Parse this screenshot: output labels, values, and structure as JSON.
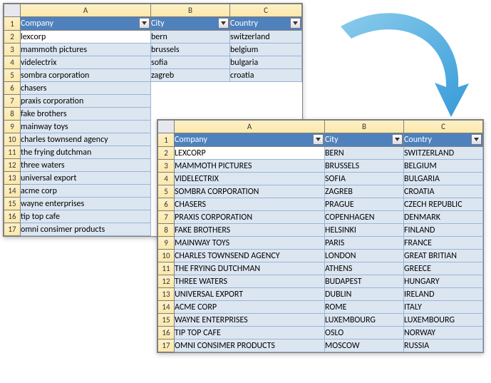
{
  "columns": [
    "A",
    "B",
    "C"
  ],
  "headers": {
    "company": "Company",
    "city": "City",
    "country": "Country"
  },
  "sheet1": {
    "visibleCols": 3,
    "cutB": 5,
    "rows": [
      {
        "n": 1
      },
      {
        "n": 2,
        "a": "lexcorp",
        "b": "bern",
        "c": "switzerland",
        "active": true
      },
      {
        "n": 3,
        "a": "mammoth pictures",
        "b": "brussels",
        "c": "belgium"
      },
      {
        "n": 4,
        "a": "videlectrix",
        "b": "sofia",
        "c": "bulgaria"
      },
      {
        "n": 5,
        "a": "sombra corporation",
        "b": "zagreb",
        "c": "croatia"
      },
      {
        "n": 6,
        "a": "chasers"
      },
      {
        "n": 7,
        "a": "praxis corporation"
      },
      {
        "n": 8,
        "a": "fake brothers"
      },
      {
        "n": 9,
        "a": "mainway toys"
      },
      {
        "n": 10,
        "a": "charles townsend agency"
      },
      {
        "n": 11,
        "a": "the frying dutchman"
      },
      {
        "n": 12,
        "a": "three waters"
      },
      {
        "n": 13,
        "a": "universal export"
      },
      {
        "n": 14,
        "a": "acme corp"
      },
      {
        "n": 15,
        "a": "wayne enterprises"
      },
      {
        "n": 16,
        "a": "tip top cafe"
      },
      {
        "n": 17,
        "a": "omni consimer products"
      }
    ]
  },
  "sheet2": {
    "rows": [
      {
        "n": 1
      },
      {
        "n": 2,
        "a": "LEXCORP",
        "b": "BERN",
        "c": "SWITZERLAND",
        "active": true
      },
      {
        "n": 3,
        "a": "MAMMOTH PICTURES",
        "b": "BRUSSELS",
        "c": "BELGIUM"
      },
      {
        "n": 4,
        "a": "VIDELECTRIX",
        "b": "SOFIA",
        "c": "BULGARIA"
      },
      {
        "n": 5,
        "a": "SOMBRA CORPORATION",
        "b": "ZAGREB",
        "c": "CROATIA"
      },
      {
        "n": 6,
        "a": "CHASERS",
        "b": "PRAGUE",
        "c": "CZECH REPUBLIC"
      },
      {
        "n": 7,
        "a": "PRAXIS CORPORATION",
        "b": "COPENHAGEN",
        "c": "DENMARK"
      },
      {
        "n": 8,
        "a": "FAKE BROTHERS",
        "b": "HELSINKI",
        "c": "FINLAND"
      },
      {
        "n": 9,
        "a": "MAINWAY TOYS",
        "b": "PARIS",
        "c": "FRANCE"
      },
      {
        "n": 10,
        "a": "CHARLES TOWNSEND AGENCY",
        "b": "LONDON",
        "c": "GREAT BRITIAN"
      },
      {
        "n": 11,
        "a": "THE FRYING DUTCHMAN",
        "b": "ATHENS",
        "c": "GREECE"
      },
      {
        "n": 12,
        "a": "THREE WATERS",
        "b": "BUDAPEST",
        "c": "HUNGARY"
      },
      {
        "n": 13,
        "a": "UNIVERSAL EXPORT",
        "b": "DUBLIN",
        "c": "IRELAND"
      },
      {
        "n": 14,
        "a": "ACME CORP",
        "b": "ROME",
        "c": "ITALY"
      },
      {
        "n": 15,
        "a": "WAYNE ENTERPRISES",
        "b": "LUXEMBOURG",
        "c": "LUXEMBOURG"
      },
      {
        "n": 16,
        "a": "TIP TOP CAFE",
        "b": "OSLO",
        "c": "NORWAY"
      },
      {
        "n": 17,
        "a": "OMNI CONSIMER PRODUCTS",
        "b": "MOSCOW",
        "c": "RUSSIA"
      }
    ]
  }
}
